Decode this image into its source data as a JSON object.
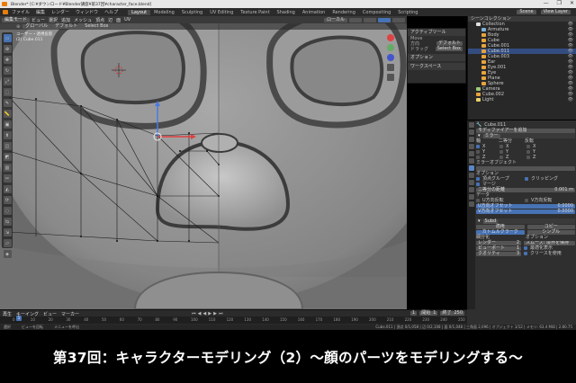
{
  "window": {
    "title": "Blender* [C:¥ダウンロード¥Blender講座¥第37回¥character_face.blend]",
    "controls": [
      "—",
      "❐",
      "✕"
    ]
  },
  "menubar": {
    "items": [
      "ファイル",
      "編集",
      "レンダー",
      "ウィンドウ",
      "ヘルプ"
    ],
    "workspaces": [
      "Layout",
      "Modeling",
      "Sculpting",
      "UV Editing",
      "Texture Paint",
      "Shading",
      "Animation",
      "Rendering",
      "Compositing",
      "Scripting"
    ],
    "active_workspace": "Layout",
    "scene_label": "Scene",
    "view_layer_label": "View Layer"
  },
  "viewport": {
    "mode": "編集モード",
    "menus": [
      "ビュー",
      "選択",
      "追加",
      "メッシュ",
      "頂点",
      "辺",
      "面",
      "UV"
    ],
    "transform_orientation": "グローバル",
    "pivot": "デフォルト",
    "drag": "Select Box",
    "overlay_label": "ローカル",
    "info_lines": [
      "ユーザー・透視投影",
      "(2) Cube.011",
      ""
    ],
    "tools": [
      "select-box",
      "cursor",
      "move",
      "rotate",
      "scale",
      "transform",
      "annotate",
      "measure",
      "add-cube",
      "extrude",
      "inset",
      "bevel",
      "loopcut",
      "knife",
      "polybuild",
      "spin",
      "smooth",
      "edge-slide",
      "shrink",
      "shear",
      "rip"
    ]
  },
  "tool_properties": {
    "header": "アクティブツール",
    "tool_name": "Move",
    "drag_label": "ドラッグ",
    "drag_value": "Select Box",
    "options_label": "オプション",
    "workspace_label": "ワークスペース",
    "orientation_label": "方向",
    "orientation_value": "デフォルト"
  },
  "outliner": {
    "header": "シーンコレクション",
    "rows": [
      {
        "name": "Collection",
        "indent": 1,
        "color": "#e0e0e0",
        "selected": false
      },
      {
        "name": "Armature",
        "indent": 2,
        "color": "#7ab0d9",
        "selected": false
      },
      {
        "name": "Body",
        "indent": 2,
        "color": "#e8a33d",
        "selected": false
      },
      {
        "name": "Cube",
        "indent": 2,
        "color": "#e8a33d",
        "selected": false
      },
      {
        "name": "Cube.001",
        "indent": 2,
        "color": "#e8a33d",
        "selected": false
      },
      {
        "name": "Cube.011",
        "indent": 2,
        "color": "#e8a33d",
        "selected": true
      },
      {
        "name": "Cube.003",
        "indent": 2,
        "color": "#e8a33d",
        "selected": false
      },
      {
        "name": "Ear",
        "indent": 2,
        "color": "#e8a33d",
        "selected": false
      },
      {
        "name": "Eye.001",
        "indent": 2,
        "color": "#e8a33d",
        "selected": false
      },
      {
        "name": "Eye",
        "indent": 2,
        "color": "#e8a33d",
        "selected": false
      },
      {
        "name": "Plane",
        "indent": 2,
        "color": "#e8a33d",
        "selected": false
      },
      {
        "name": "Sphere",
        "indent": 2,
        "color": "#e8a33d",
        "selected": false
      },
      {
        "name": "Camera",
        "indent": 1,
        "color": "#9fc97a",
        "selected": false
      },
      {
        "name": "Cube.002",
        "indent": 1,
        "color": "#e8a33d",
        "selected": false
      },
      {
        "name": "Light",
        "indent": 1,
        "color": "#e8d16a",
        "selected": false
      }
    ]
  },
  "properties": {
    "object_name": "Cube.011",
    "modifier_header": "モディファイアーを追加",
    "mirror_name": "ミラー",
    "axis_label": "軸",
    "bisect_label": "二等分",
    "flip_label": "反転",
    "axes": [
      "X",
      "Y",
      "Z"
    ],
    "mirror_object_label": "ミラーオブジェクト",
    "options_label": "オプション",
    "vertex_groups_label": "頂点グループ",
    "clipping_label": "クリッピング",
    "merge_label": "マージ",
    "merge_value": "0.001 m",
    "bisect_distance_label": "二等分の距離",
    "data_label": "データ",
    "u_mirror": "U方向反転",
    "v_mirror": "V方向反転",
    "u_offset_label": "U方向オフセット",
    "u_offset_value": "0.0000",
    "v_offset_label": "V方向オフセット",
    "v_offset_value": "0.0000",
    "subsurf_name": "Subd",
    "apply_label": "適用",
    "copy_label": "コピー",
    "catmull_label": "カトムルクラーク",
    "simple_label": "シンプル",
    "subdivisions_label": "細分化",
    "render_label": "レンダー",
    "render_value": "2",
    "viewport_label": "ビューポート",
    "viewport_value": "1",
    "quality_label": "クオリティ",
    "quality_value": "3",
    "options2_label": "オプション",
    "smooth_label": "スムーズ: 境界を保持",
    "optimal_label": "最適化表示",
    "use_creases": "クリースを使用"
  },
  "timeline": {
    "menus": [
      "再生",
      "キーイング",
      "ビュー",
      "マーカー"
    ],
    "current_frame": "1",
    "start_label": "開始",
    "start_value": "1",
    "end_label": "終了",
    "end_value": "250",
    "ticks": [
      "0",
      "10",
      "20",
      "30",
      "40",
      "50",
      "60",
      "70",
      "80",
      "90",
      "100",
      "110",
      "120",
      "130",
      "140",
      "150",
      "160",
      "170",
      "180",
      "190",
      "200",
      "210",
      "220",
      "230",
      "240",
      "250"
    ]
  },
  "statusbar": {
    "left": "選択",
    "middle": "ビューを回転",
    "right": "メニューを呼出",
    "stats": "Cube.011 | 頂点 0/1,058 | 辺 0/2,108 | 面 0/1,048 | 三角面 2,096 | オブジェクト 1/12 | メモリ: 63.4 MiB | 2.80.75"
  },
  "caption": "第37回：キャラクターモデリング（2）〜顔のパーツをモデリングする〜"
}
